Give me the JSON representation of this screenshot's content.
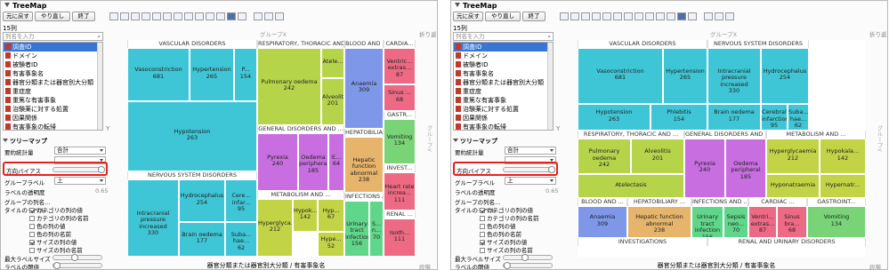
{
  "panels": [
    {
      "title": "TreeMap",
      "toolbar": {
        "buttons": [
          "元に戻す",
          "やり直し",
          "終了"
        ]
      },
      "column_count": "15列",
      "search_placeholder": "列名を入力",
      "columns": [
        "調査ID",
        "ドメイン",
        "被験者ID",
        "有害事象名",
        "器官分類または器官別大分類",
        "重症度",
        "重篤な有害事象",
        "治験薬に対する処置",
        "因果関係",
        "有害事象の転帰"
      ],
      "controls": {
        "section": "ツリーマップ",
        "summary_label": "要約統計量",
        "summary_value": "合計",
        "summary2_label": "",
        "summary2_value": "",
        "bias_label": "方向バイアス",
        "group_label": "グループラベル",
        "group_value": "上",
        "label_opacity": "ラベルの透明度",
        "label_opacity_value": "0.65",
        "group_name_label": "グループの列名...",
        "tile_label": "タイルのラベル...",
        "checks": [
          {
            "label": "カテゴリの列の値",
            "on": true
          },
          {
            "label": "カテゴリの列の名前",
            "on": false
          },
          {
            "label": "色の列の値",
            "on": false
          },
          {
            "label": "色の列の名前",
            "on": false
          },
          {
            "label": "サイズの列の値",
            "on": true
          },
          {
            "label": "サイズの列の名前",
            "on": false
          }
        ],
        "max_label": "最大ラベルサイズ",
        "label_threshold": "ラベルの閾値"
      },
      "graph": {
        "x_title": "グループX",
        "y_title": "Y",
        "right_title": "グループY",
        "wrap": "折り返し",
        "page": "段階",
        "bottom": "器官分類または器官別大分類 / 有害事象名",
        "x_axis": "X",
        "y_axis": "Y"
      }
    },
    {
      "title": "TreeMap",
      "toolbar": {
        "buttons": [
          "元に戻す",
          "やり直し",
          "終了"
        ]
      },
      "column_count": "15列",
      "search_placeholder": "列名を入力",
      "columns": [
        "調査ID",
        "ドメイン",
        "被験者ID",
        "有害事象名",
        "器官分類または器官別大分類",
        "重症度",
        "重篤な有害事象",
        "治験薬に対する処置",
        "因果関係",
        "有害事象の転帰"
      ],
      "controls": {
        "section": "ツリーマップ",
        "summary_label": "要約統計量",
        "summary_value": "合計",
        "summary2_label": "",
        "summary2_value": "",
        "bias_label": "方向バイアス",
        "group_label": "グループラベル",
        "group_value": "上",
        "label_opacity": "ラベルの透明度",
        "label_opacity_value": "0.65",
        "group_name_label": "グループの列名...",
        "tile_label": "タイルのラベル...",
        "checks": [
          {
            "label": "カテゴリの列の値",
            "on": true
          },
          {
            "label": "カテゴリの列の名前",
            "on": false
          },
          {
            "label": "色の列の値",
            "on": false
          },
          {
            "label": "色の列の名前",
            "on": false
          },
          {
            "label": "サイズの列の値",
            "on": true
          },
          {
            "label": "サイズの列の名前",
            "on": false
          }
        ],
        "max_label": "最大ラベルサイズ",
        "label_threshold": "ラベルの閾値"
      },
      "graph": {
        "x_title": "グループX",
        "y_title": "Y",
        "right_title": "グループY",
        "wrap": "折り返し",
        "page": "段階",
        "bottom": "器官分類または器官別大分類 / 有害事象名",
        "x_axis": "X",
        "y_axis": "Y"
      }
    }
  ],
  "left_groups": [
    {
      "name": "VASCULAR DISORDERS"
    },
    {
      "name": "RESPIRATORY, THORACIC AND ..."
    },
    {
      "name": "BLOOD AND ..."
    },
    {
      "name": "CARDIA..."
    },
    {
      "name": "NERVOUS SYSTEM DISORDERS"
    },
    {
      "name": "GENERAL DISORDERS AND ..."
    },
    {
      "name": "HEPATOBILIA..."
    },
    {
      "name": "GASTR..."
    },
    {
      "name": "INVEST..."
    },
    {
      "name": "METABOLISM AND ..."
    },
    {
      "name": "INFECTIONS AND ..."
    },
    {
      "name": "RENAL ..."
    }
  ],
  "left_tiles": [
    {
      "name": "Vasoconstriction",
      "value": "681",
      "color": "#3ec6d6"
    },
    {
      "name": "Hypertension",
      "value": "265",
      "color": "#3ec6d6"
    },
    {
      "name": "P...",
      "value": "154",
      "color": "#3ec6d6"
    },
    {
      "name": "Hypotension",
      "value": "263",
      "color": "#3ec6d6"
    },
    {
      "name": "Pulmonary oedema",
      "value": "242",
      "color": "#b6d44a"
    },
    {
      "name": "Atele...",
      "value": "",
      "color": "#b6d44a"
    },
    {
      "name": "Alveolitis",
      "value": "201",
      "color": "#b6d44a"
    },
    {
      "name": "Anaemia",
      "value": "309",
      "color": "#7f97e8"
    },
    {
      "name": "Ventric... extras...",
      "value": "87",
      "color": "#ee6a84"
    },
    {
      "name": "Sinus ...",
      "value": "68",
      "color": "#ee6a84"
    },
    {
      "name": "Intracranial pressure increased",
      "value": "330",
      "color": "#3ec6d6"
    },
    {
      "name": "Hydrocephalus",
      "value": "254",
      "color": "#3ec6d6"
    },
    {
      "name": "Cere... infar...",
      "value": "95",
      "color": "#3ec6d6"
    },
    {
      "name": "Brain oedema",
      "value": "177",
      "color": "#3ec6d6"
    },
    {
      "name": "Suba... hae...",
      "value": "62",
      "color": "#3ec6d6"
    },
    {
      "name": "Pyrexia",
      "value": "240",
      "color": "#c86ee0"
    },
    {
      "name": "Oedema peripheral",
      "value": "185",
      "color": "#c86ee0"
    },
    {
      "name": "E...",
      "value": "64",
      "color": "#c86ee0"
    },
    {
      "name": "Hepatic function abnormal",
      "value": "238",
      "color": "#e6b46a"
    },
    {
      "name": "Vomiting",
      "value": "134",
      "color": "#78d476"
    },
    {
      "name": "Heart rate increa...",
      "value": "111",
      "color": "#ee6a84"
    },
    {
      "name": "Hyperglyca...",
      "value": "212",
      "color": "#c2d446"
    },
    {
      "name": "Hypok...",
      "value": "142",
      "color": "#c2d446"
    },
    {
      "name": "Hyp...",
      "value": "67",
      "color": "#c2d446"
    },
    {
      "name": "Hype...",
      "value": "52",
      "color": "#c2d446"
    },
    {
      "name": "Urinary tract infection",
      "value": "156",
      "color": "#60d68a"
    },
    {
      "name": "S... n...",
      "value": "70",
      "color": "#60d68a"
    },
    {
      "name": "Isoth...",
      "value": "111",
      "color": "#ee6a84"
    }
  ],
  "right_groups": [
    {
      "name": "VASCULAR DISORDERS"
    },
    {
      "name": "NERVOUS SYSTEM DISORDERS"
    },
    {
      "name": "RESPIRATORY, THORACIC AND ..."
    },
    {
      "name": "GENERAL DISORDERS AND ..."
    },
    {
      "name": "METABOLISM AND ..."
    },
    {
      "name": "BLOOD AND ..."
    },
    {
      "name": "HEPATOBILIARY ..."
    },
    {
      "name": "INFECTIONS AND ..."
    },
    {
      "name": "CARDIAC ..."
    },
    {
      "name": "GASTROINT..."
    },
    {
      "name": "INVESTIGATIONS"
    },
    {
      "name": "RENAL AND URINARY DISORDERS"
    }
  ],
  "right_tiles": [
    {
      "name": "Vasoconstriction",
      "value": "681",
      "color": "#3ec6d6"
    },
    {
      "name": "Hypertension",
      "value": "265",
      "color": "#3ec6d6"
    },
    {
      "name": "Hypotension",
      "value": "263",
      "color": "#3ec6d6"
    },
    {
      "name": "Phlebitis",
      "value": "154",
      "color": "#3ec6d6"
    },
    {
      "name": "Intracranial pressure increased",
      "value": "330",
      "color": "#3ec6d6"
    },
    {
      "name": "Hydrocephalus",
      "value": "254",
      "color": "#3ec6d6"
    },
    {
      "name": "Brain oedema",
      "value": "177",
      "color": "#3ec6d6"
    },
    {
      "name": "Cerebral infarction",
      "value": "95",
      "color": "#3ec6d6"
    },
    {
      "name": "Suba... hae...",
      "value": "62",
      "color": "#3ec6d6"
    },
    {
      "name": "Pulmonary oedema",
      "value": "242",
      "color": "#b6d44a"
    },
    {
      "name": "Alveolitis",
      "value": "201",
      "color": "#b6d44a"
    },
    {
      "name": "Atelectasis",
      "value": "",
      "color": "#b6d44a"
    },
    {
      "name": "Pyrexia",
      "value": "240",
      "color": "#c86ee0"
    },
    {
      "name": "Oedema peripheral",
      "value": "185",
      "color": "#c86ee0"
    },
    {
      "name": "Hyperglycaemia",
      "value": "212",
      "color": "#c2d446"
    },
    {
      "name": "Hypokala...",
      "value": "142",
      "color": "#c2d446"
    },
    {
      "name": "Hyponatraemia",
      "value": "",
      "color": "#c2d446"
    },
    {
      "name": "Hypernatr...",
      "value": "",
      "color": "#c2d446"
    },
    {
      "name": "Anaemia",
      "value": "309",
      "color": "#7f97e8"
    },
    {
      "name": "Hepatic function abnormal",
      "value": "238",
      "color": "#e6b46a"
    },
    {
      "name": "Urinary tract infection",
      "value": "156",
      "color": "#60d68a"
    },
    {
      "name": "Sepsis neo...",
      "value": "70",
      "color": "#60d68a"
    },
    {
      "name": "Ventri... extras...",
      "value": "87",
      "color": "#ee6a84"
    },
    {
      "name": "Sinus bra...",
      "value": "68",
      "color": "#ee6a84"
    },
    {
      "name": "Vomiting",
      "value": "134",
      "color": "#78d476"
    }
  ]
}
